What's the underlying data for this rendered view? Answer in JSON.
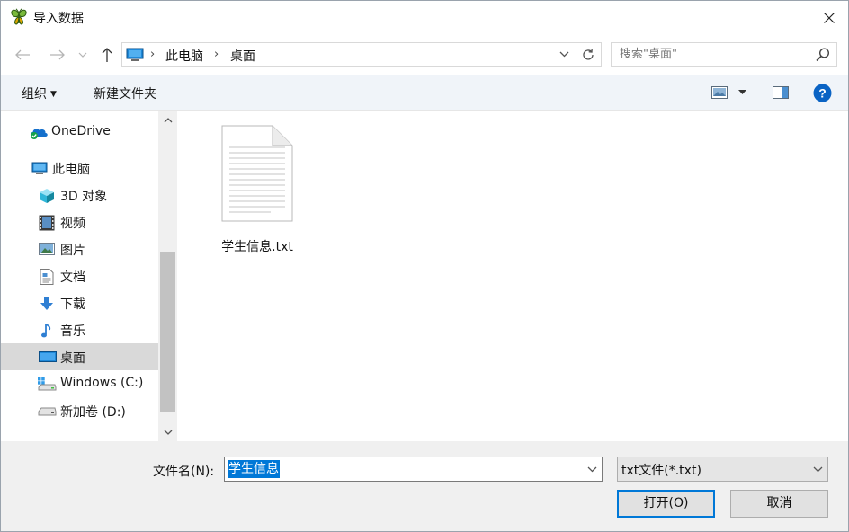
{
  "window": {
    "title": "导入数据",
    "icon": "butterfly-app-icon",
    "close_icon": "close-icon"
  },
  "address": {
    "segments": [
      "此电脑",
      "桌面"
    ],
    "back_icon": "arrow-left-icon",
    "forward_icon": "arrow-right-icon",
    "recent_icon": "chevron-down-icon",
    "up_icon": "arrow-up-icon",
    "refresh_icon": "refresh-icon"
  },
  "search": {
    "placeholder": "搜索\"桌面\"",
    "icon": "search-icon"
  },
  "toolbar": {
    "organize_label": "组织",
    "new_folder_label": "新建文件夹"
  },
  "nav": {
    "items": [
      {
        "label": "OneDrive",
        "icon": "onedrive-cloud-icon"
      },
      {
        "label": "此电脑",
        "icon": "computer-icon"
      },
      {
        "label": "3D 对象",
        "icon": "3d-objects-icon"
      },
      {
        "label": "视频",
        "icon": "video-icon"
      },
      {
        "label": "图片",
        "icon": "pictures-icon"
      },
      {
        "label": "文档",
        "icon": "documents-icon"
      },
      {
        "label": "下载",
        "icon": "download-icon"
      },
      {
        "label": "音乐",
        "icon": "music-icon"
      },
      {
        "label": "桌面",
        "icon": "desktop-icon",
        "selected": true
      },
      {
        "label": "Windows (C:)",
        "icon": "windows-drive-icon"
      },
      {
        "label": "新加卷 (D:)",
        "icon": "drive-icon"
      }
    ]
  },
  "files": [
    {
      "name": "学生信息.txt",
      "icon": "text-file-icon"
    }
  ],
  "bottom": {
    "filename_label": "文件名(N):",
    "filename_value": "学生信息",
    "filetype_value": "txt文件(*.txt)",
    "open_label": "打开(O)",
    "cancel_label": "取消"
  },
  "colors": {
    "accent": "#0078d7",
    "selection": "#d9d9d9",
    "commandbar": "#f0f4f9",
    "panel": "#f0f0f0"
  }
}
